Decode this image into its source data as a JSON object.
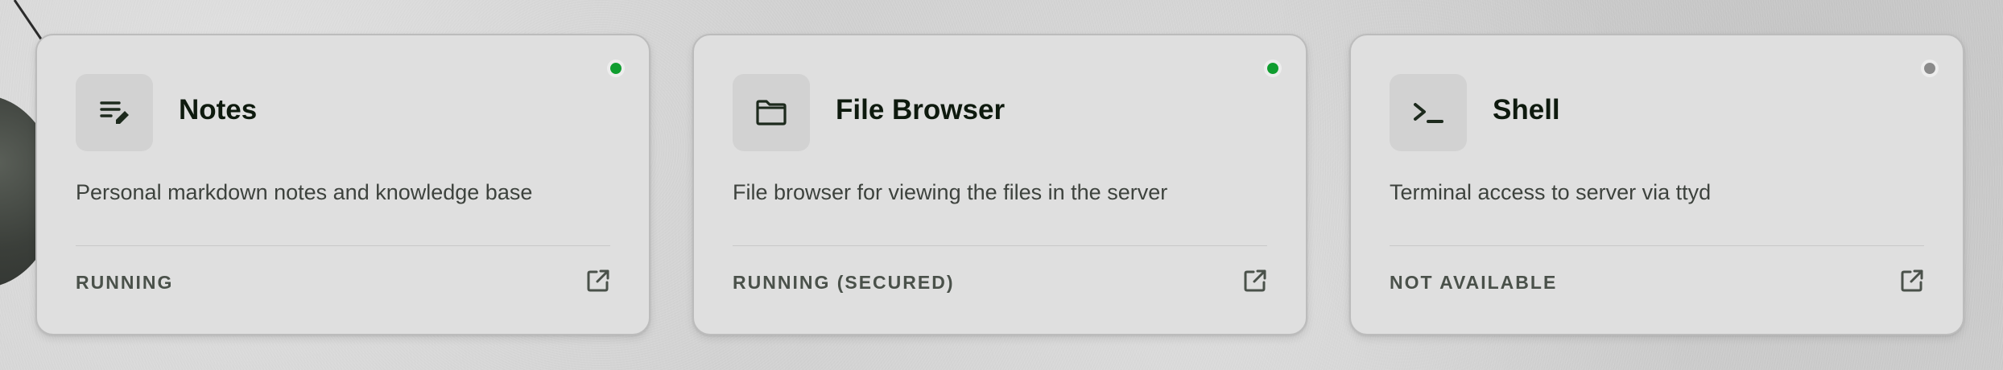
{
  "colors": {
    "status_running": "#0f9d2f",
    "status_unavailable": "#8a8a8a",
    "card_background": "#dfdfdf",
    "text_primary": "#0e1a0e",
    "text_secondary": "#3d423d"
  },
  "cards": [
    {
      "title": "Notes",
      "description": "Personal markdown notes and knowledge base",
      "status": "RUNNING",
      "status_indicator": "green",
      "icon": "notes-edit-icon",
      "link_icon": "open-external-icon"
    },
    {
      "title": "File Browser",
      "description": "File browser for viewing the files in the server",
      "status": "RUNNING (SECURED)",
      "status_indicator": "green",
      "icon": "folder-icon",
      "link_icon": "open-external-icon"
    },
    {
      "title": "Shell",
      "description": "Terminal access to server via ttyd",
      "status": "NOT AVAILABLE",
      "status_indicator": "grey",
      "icon": "terminal-icon",
      "link_icon": "open-external-icon"
    }
  ]
}
